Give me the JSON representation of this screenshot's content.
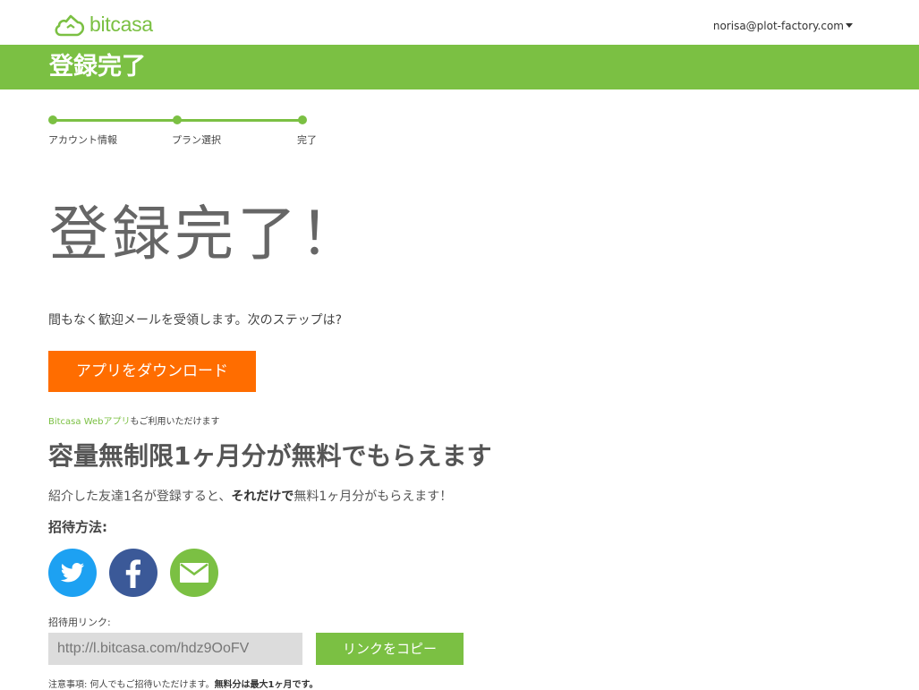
{
  "header": {
    "logo_text": "bitcasa",
    "user_email": "norisa@plot-factory.com"
  },
  "banner": {
    "title": "登録完了"
  },
  "steps": [
    {
      "label": "アカウント情報"
    },
    {
      "label": "プラン選択"
    },
    {
      "label": "完了"
    }
  ],
  "main": {
    "big_title": "登録完了！",
    "welcome_text": "間もなく歓迎メールを受領します。次のステップは?",
    "download_button": "アプリをダウンロード",
    "webapp_link": "Bitcasa Webアプリ",
    "webapp_suffix": "もご利用いただけます"
  },
  "promo": {
    "title": "容量無制限1ヶ月分が無料でもらえます",
    "desc_prefix": "紹介した友達1名が登録すると、",
    "desc_bold": "それだけで",
    "desc_suffix": "無料1ヶ月分がもらえます！",
    "invite_heading": "招待方法:"
  },
  "invite": {
    "link_label": "招待用リンク:",
    "link_value": "http://l.bitcasa.com/hdz9OoFV",
    "copy_button": "リンクをコピー",
    "note_prefix": "注意事項: 何人でもご招待いただけます。",
    "note_bold": "無料分は最大1ヶ月です。"
  },
  "colors": {
    "brand_green": "#7bc043",
    "accent_orange": "#ff6d00",
    "twitter_blue": "#1da1f2",
    "facebook_blue": "#3b5998"
  },
  "icons": {
    "logo": "cloud-house-icon",
    "user_menu": "caret-down-icon",
    "twitter": "twitter-bird-icon",
    "facebook": "facebook-f-icon",
    "email": "envelope-icon"
  }
}
